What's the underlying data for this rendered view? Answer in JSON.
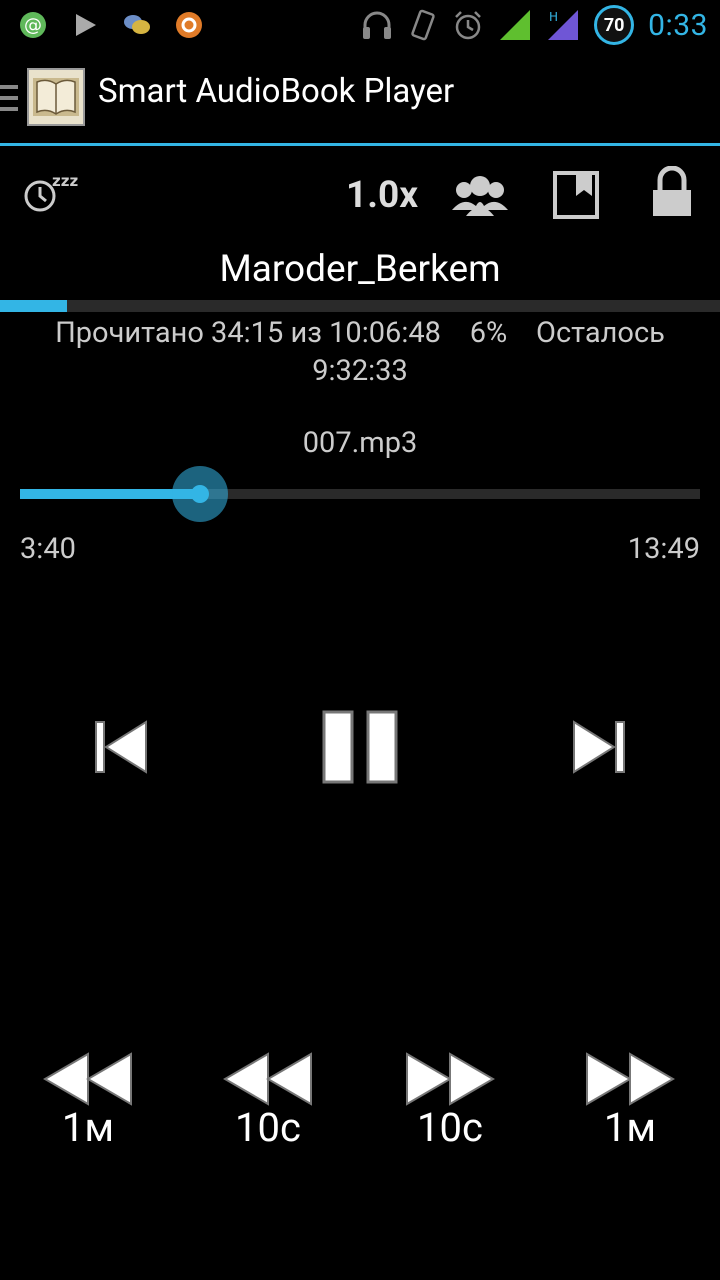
{
  "status_bar": {
    "time": "0:33",
    "battery": "70",
    "network_label": "H"
  },
  "action_bar": {
    "title": "Smart AudioBook Player"
  },
  "controls": {
    "speed": "1.0x"
  },
  "book": {
    "title": "Maroder_Berkem",
    "progress": 0.06,
    "stats_line1": "Прочитано 34:15 из 10:06:48    6%    Осталось",
    "stats_line2": "9:32:33"
  },
  "track": {
    "filename": "007.mp3",
    "elapsed": "3:40",
    "duration": "13:49",
    "position": 0.265
  },
  "skip_buttons": {
    "back_1m": "1м",
    "back_10s": "10с",
    "fwd_10s": "10с",
    "fwd_1m": "1м"
  },
  "colors": {
    "accent": "#33b5e5",
    "background": "#000000"
  }
}
